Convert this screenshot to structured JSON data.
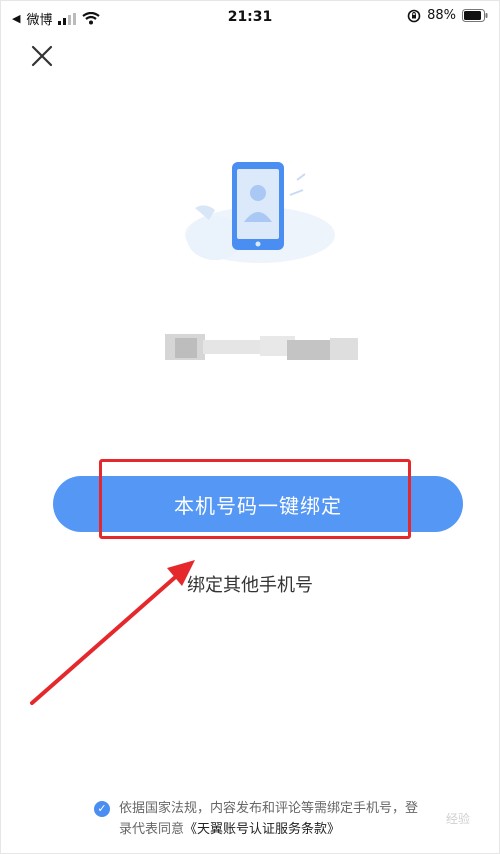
{
  "status_bar": {
    "back_app": "微博",
    "time": "21:31",
    "battery": "88%"
  },
  "primary_button": "本机号码一键绑定",
  "secondary_link": "绑定其他手机号",
  "agreement": {
    "text": "依据国家法规，内容发布和评论等需绑定手机号，登录代表同意",
    "terms": "《天翼账号认证服务条款》"
  },
  "watermark": "经验",
  "colors": {
    "primary": "#5597f5",
    "highlight": "#e5282c"
  }
}
